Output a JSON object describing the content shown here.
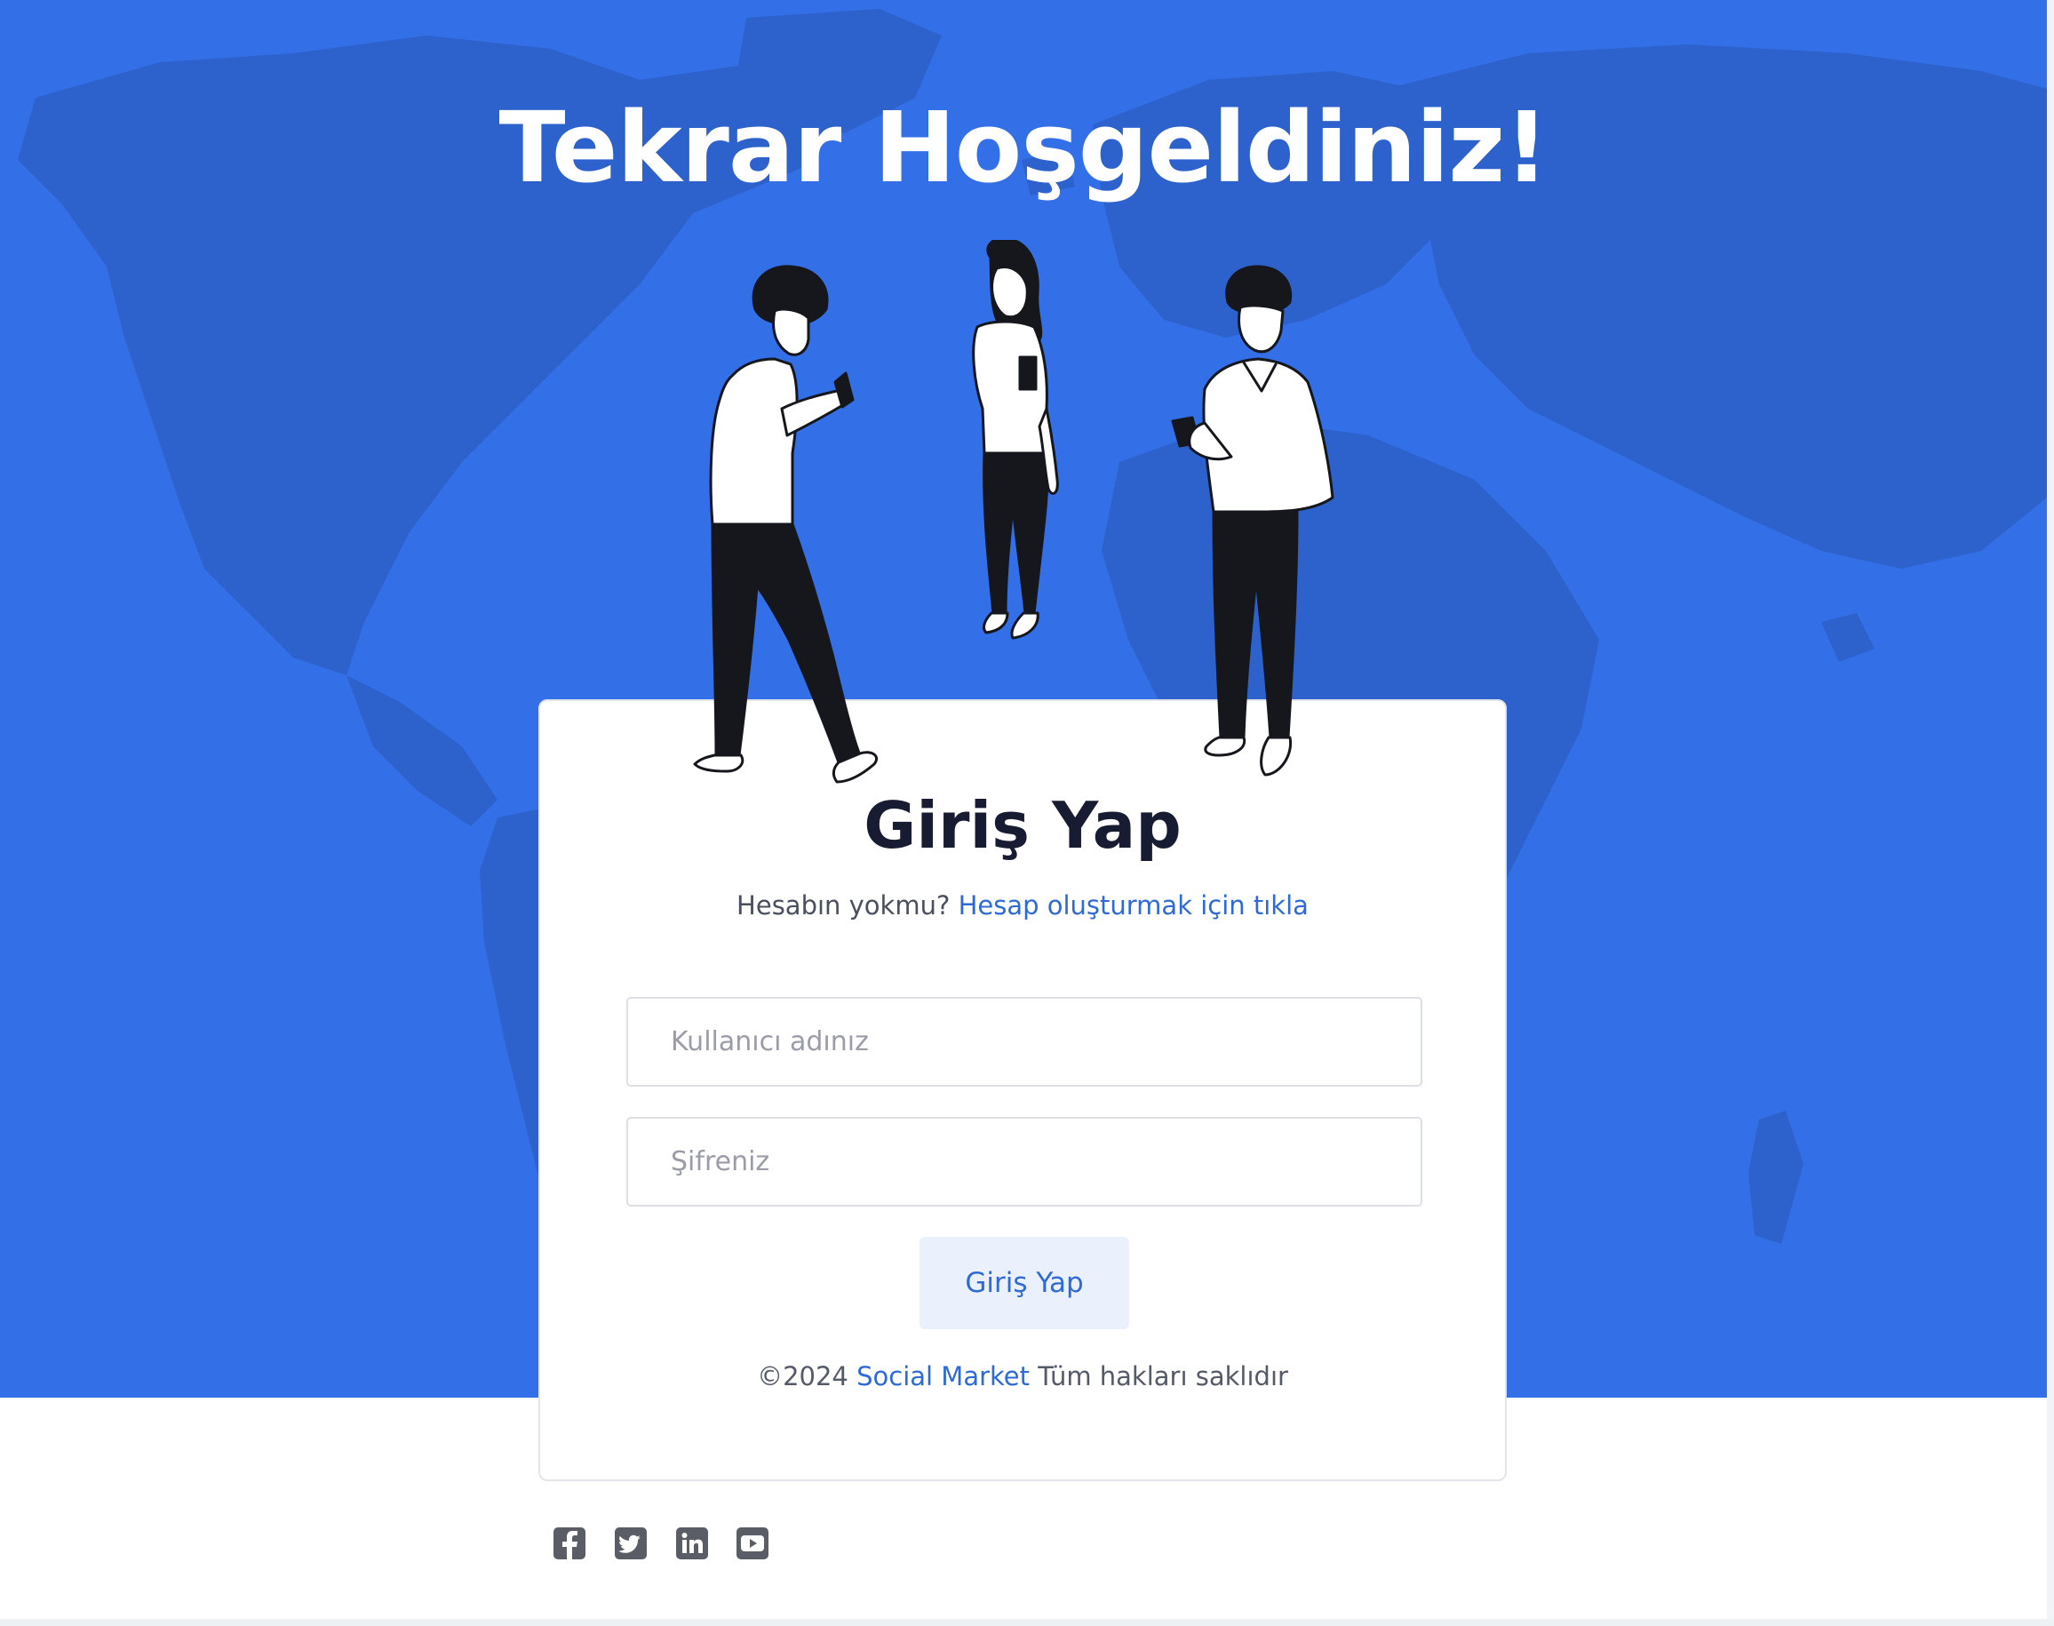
{
  "hero": {
    "title": "Tekrar Hoşgeldiniz!",
    "background_color": "#336fe6"
  },
  "login_card": {
    "title": "Giriş Yap",
    "signup_prompt": "Hesabın yokmu?",
    "signup_link": "Hesap oluşturmak için tıkla",
    "username_placeholder": "Kullanıcı adınız",
    "username_value": "",
    "password_placeholder": "Şifreniz",
    "password_value": "",
    "submit_label": "Giriş Yap",
    "copyright_year": "©2024",
    "brand_name": "Social Market",
    "rights_text": "Tüm hakları saklıdır"
  },
  "colors": {
    "accent": "#2f6ad4",
    "button_bg": "#ebf1fc",
    "title_text": "#181c32"
  },
  "social_icons": [
    {
      "name": "facebook-icon"
    },
    {
      "name": "twitter-icon"
    },
    {
      "name": "linkedin-icon"
    },
    {
      "name": "youtube-icon"
    }
  ]
}
